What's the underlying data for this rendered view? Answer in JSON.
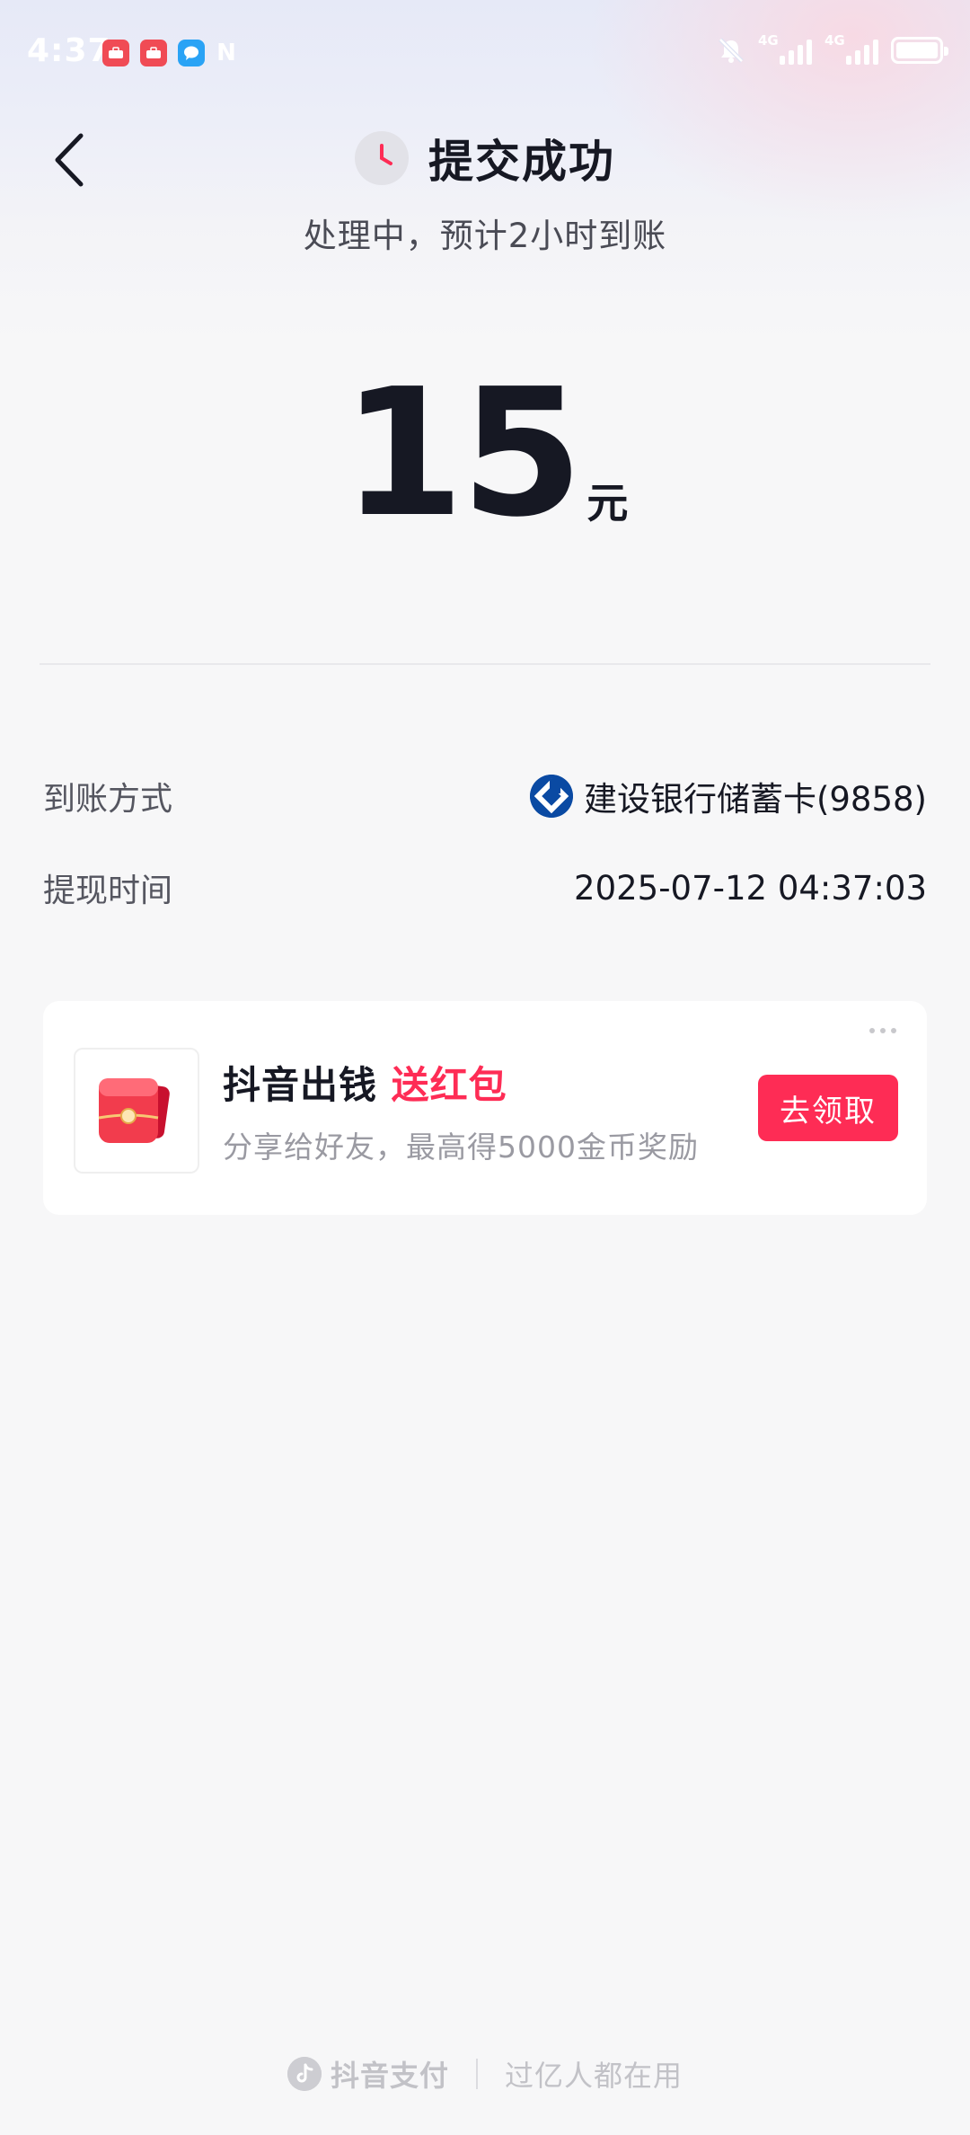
{
  "status_bar": {
    "time": "4:37",
    "notification_icons": [
      "app-icon",
      "app-icon",
      "message-icon",
      "nfc-icon"
    ],
    "nfc_glyph": "N",
    "network": [
      "4G",
      "4G"
    ],
    "battery_level": 100
  },
  "header": {
    "title": "提交成功",
    "subtitle": "处理中，预计2小时到账"
  },
  "amount": {
    "value": "15",
    "unit": "元"
  },
  "details": {
    "method_label": "到账方式",
    "method_value": "建设银行储蓄卡(9858)",
    "time_label": "提现时间",
    "time_value": "2025-07-12 04:37:03"
  },
  "promo": {
    "title_main": "抖音出钱",
    "title_highlight": "送红包",
    "subtitle": "分享给好友，最高得5000金币奖励",
    "button_label": "去领取"
  },
  "footer": {
    "brand": "抖音支付",
    "slogan": "过亿人都在用"
  },
  "colors": {
    "accent": "#fe2c55",
    "text_primary": "#161823",
    "bank_blue": "#0a4aa3"
  }
}
